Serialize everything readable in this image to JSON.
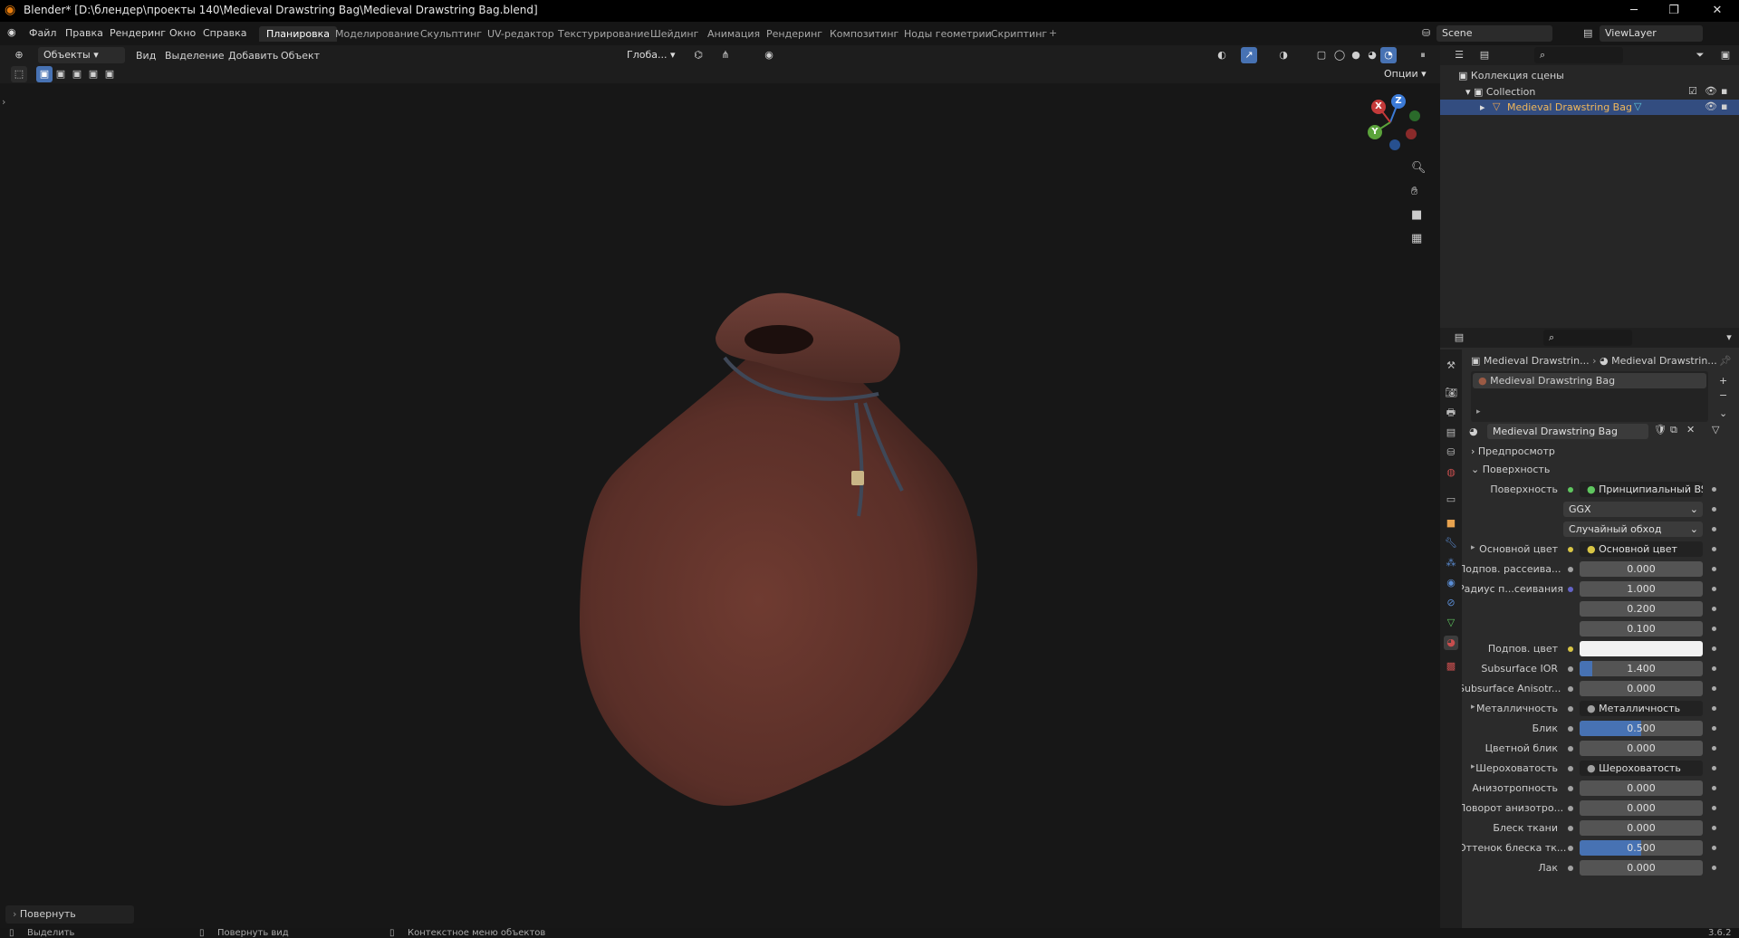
{
  "window": {
    "title": "Blender* [D:\\блендер\\проекты 140\\Medieval Drawstring Bag\\Medieval Drawstring Bag.blend]"
  },
  "menus": [
    "Файл",
    "Правка",
    "Рендеринг",
    "Окно",
    "Справка"
  ],
  "workspaces": [
    "Планировка",
    "Моделирование",
    "Скульптинг",
    "UV-редактор",
    "Текстурирование",
    "Шейдинг",
    "Анимация",
    "Рендеринг",
    "Композитинг",
    "Ноды геометрии",
    "Скриптинг"
  ],
  "active_workspace": "Планировка",
  "scene": {
    "name": "Scene",
    "view_layer": "ViewLayer"
  },
  "viewport_header": {
    "mode": "Объекты",
    "menus": [
      "Вид",
      "Выделение",
      "Добавить",
      "Объект"
    ],
    "transform": "Глоба...",
    "options": "Опции"
  },
  "gizmo": {
    "x": "X",
    "y": "Y",
    "z": "Z"
  },
  "last_op": "Повернуть",
  "outliner": {
    "root": "Коллекция сцены",
    "collection": "Collection",
    "object": "Medieval Drawstring Bag"
  },
  "properties": {
    "breadcrumb_obj": "Medieval Drawstrin...",
    "breadcrumb_mat": "Medieval Drawstrin...",
    "slot": "Medieval Drawstring Bag",
    "material": "Medieval Drawstring Bag",
    "sections": {
      "preview": "Предпросмотр",
      "surface": "Поверхность"
    },
    "rows": [
      {
        "label": "Поверхность",
        "value": "Принципиальный BSDF",
        "kind": "link",
        "dot": "#5fc65f"
      },
      {
        "label": "",
        "value": "GGX",
        "kind": "select"
      },
      {
        "label": "",
        "value": "Случайный обход",
        "kind": "select"
      },
      {
        "label": "Основной цвет",
        "value": "Основной цвет",
        "kind": "link",
        "dot": "#d8c545",
        "expand": true
      },
      {
        "label": "Подпов. рассеива...",
        "value": "0.000",
        "kind": "num",
        "dot": "#a1a1a1"
      },
      {
        "label": "Радиус п...сеивания",
        "value": "1.000",
        "kind": "num",
        "dot": "#6363c7"
      },
      {
        "label": "",
        "value": "0.200",
        "kind": "num"
      },
      {
        "label": "",
        "value": "0.100",
        "kind": "num"
      },
      {
        "label": "Подпов. цвет",
        "value": "",
        "kind": "color",
        "dot": "#d8c545"
      },
      {
        "label": "Subsurface IOR",
        "value": "1.400",
        "kind": "num",
        "dot": "#a1a1a1",
        "fill": 0.1
      },
      {
        "label": "Subsurface Anisotr...",
        "value": "0.000",
        "kind": "num",
        "dot": "#a1a1a1"
      },
      {
        "label": "Металличность",
        "value": "Металличность",
        "kind": "link",
        "dot": "#a1a1a1",
        "expand": true
      },
      {
        "label": "Блик",
        "value": "0.500",
        "kind": "num",
        "dot": "#a1a1a1",
        "fill": 0.5
      },
      {
        "label": "Цветной блик",
        "value": "0.000",
        "kind": "num",
        "dot": "#a1a1a1"
      },
      {
        "label": "Шероховатость",
        "value": "Шероховатость",
        "kind": "link",
        "dot": "#a1a1a1",
        "expand": true
      },
      {
        "label": "Анизотропность",
        "value": "0.000",
        "kind": "num",
        "dot": "#a1a1a1"
      },
      {
        "label": "Поворот анизотро...",
        "value": "0.000",
        "kind": "num",
        "dot": "#a1a1a1"
      },
      {
        "label": "Блеск ткани",
        "value": "0.000",
        "kind": "num",
        "dot": "#a1a1a1"
      },
      {
        "label": "Оттенок блеска тк...",
        "value": "0.500",
        "kind": "num",
        "dot": "#a1a1a1",
        "fill": 0.5
      },
      {
        "label": "Лак",
        "value": "0.000",
        "kind": "num",
        "dot": "#a1a1a1"
      }
    ]
  },
  "status": {
    "select": "Выделить",
    "rotate": "Повернуть вид",
    "context": "Контекстное меню объектов",
    "version": "3.6.2"
  },
  "colors": {
    "accent": "#4772b3",
    "bag": "#6e3b30",
    "selected_row": "#334d80"
  }
}
